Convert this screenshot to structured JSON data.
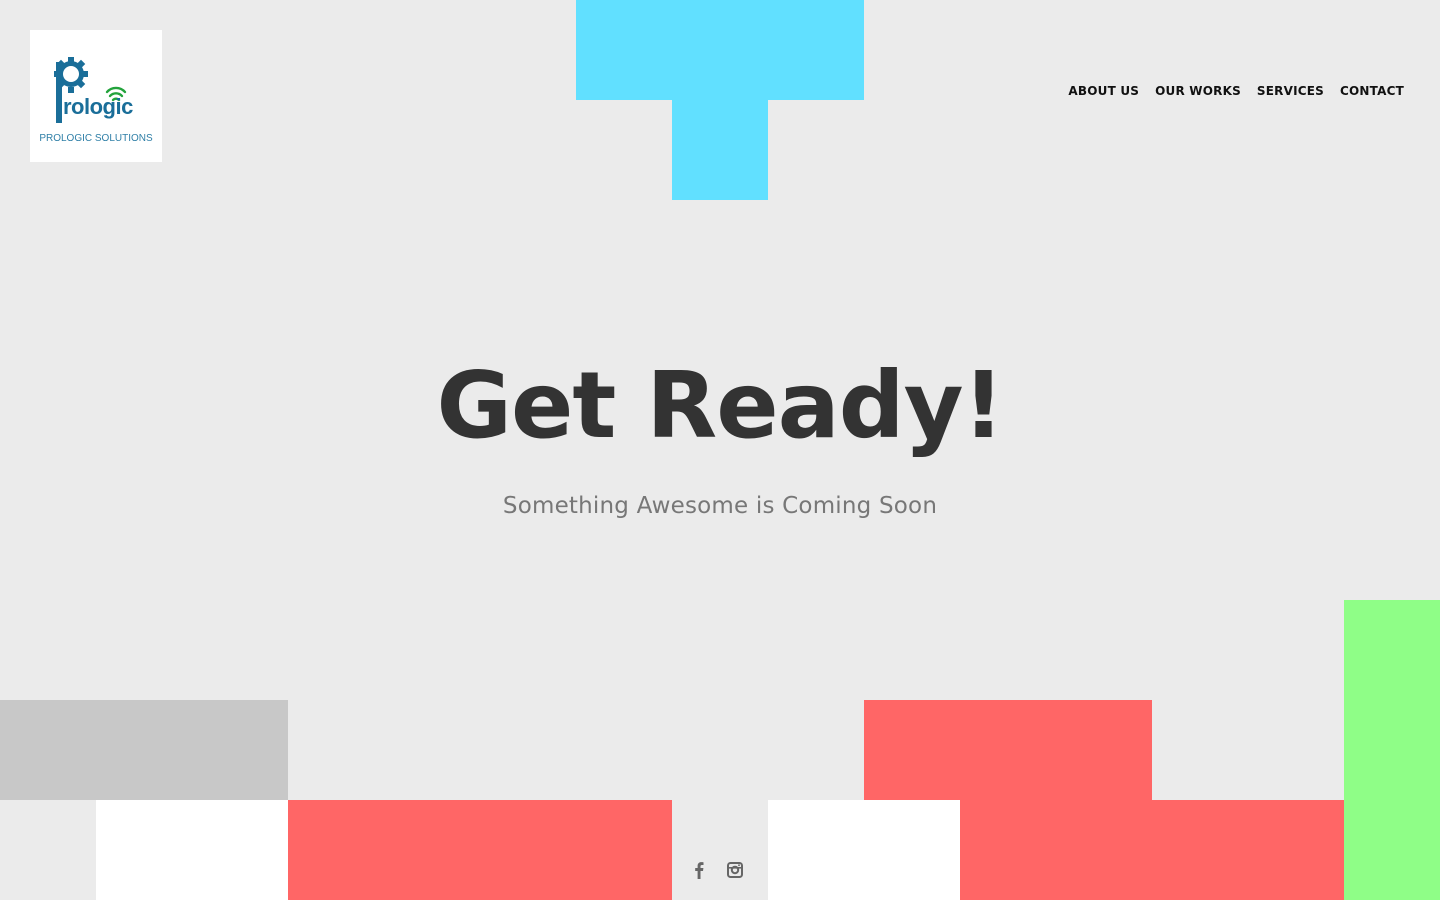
{
  "brand": {
    "logo_word": "rologic",
    "logo_letter": "P",
    "caption": "PROLOGIC SOLUTIONS",
    "primary_color": "#1a6e99",
    "accent_color": "#23a33c"
  },
  "nav": {
    "items": [
      {
        "label": "ABOUT US"
      },
      {
        "label": "OUR WORKS"
      },
      {
        "label": "SERVICES"
      },
      {
        "label": "CONTACT"
      }
    ]
  },
  "hero": {
    "title": "Get Ready!",
    "subtitle": "Something Awesome is Coming Soon"
  },
  "social": {
    "items": [
      {
        "icon": "facebook-icon"
      },
      {
        "icon": "instagram-icon"
      }
    ]
  },
  "colors": {
    "background": "#ebebeb",
    "cyan": "#61e0ff",
    "red": "#ff6666",
    "grey": "#c8c8c8",
    "white": "#ffffff",
    "green": "#8ffe87",
    "heading": "#333333",
    "subheading": "#777777"
  }
}
